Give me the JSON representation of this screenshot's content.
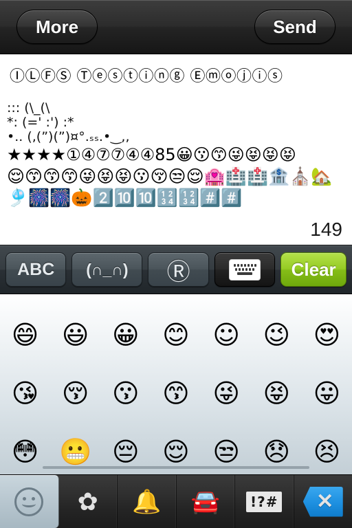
{
  "top_toolbar": {
    "more_label": "More",
    "send_label": "Send"
  },
  "message": {
    "title": "ⒾⓁⒻⓈ Ⓣⓔⓢⓣⓘⓝⓖ Ⓔⓜⓞⓙⓘⓢ",
    "ascii_art": "::: (\\_(\\\n*: (=' :') :*\n•.. (,(”)(”)¤°.ₛₛ.•‿,,",
    "emoji_line_1": "★★★★①④⑦⑦④④85😀😗😙😜😝😝😝",
    "emoji_line_2": "😌😙😙😙😜😝😝😗😚😒😌🏩🏥🏥🏦⛪🏡",
    "emoji_line_3": "🎐🎆🎆🎃2️⃣🔟🔟🔢🔢#️⃣#️⃣",
    "char_count": "149"
  },
  "mid_bar": {
    "abc_label": "ABC",
    "kaomoji_label": "(∩_∩)",
    "registered_label": "Ⓡ",
    "keyboard_icon": "keyboard-icon",
    "clear_label": "Clear"
  },
  "emoji_pad": {
    "rows": [
      [
        "😄",
        "😃",
        "😀",
        "😊",
        "☺",
        "😉",
        "😍"
      ],
      [
        "😘",
        "😚",
        "😗",
        "😙",
        "😜",
        "😝",
        "😛"
      ],
      [
        "😳",
        "😬",
        "😔",
        "😌",
        "😒",
        "😞",
        "😣"
      ]
    ]
  },
  "tabbar": {
    "tabs": [
      {
        "name": "tab-smileys",
        "icon": "smiley-icon",
        "glyph": ""
      },
      {
        "name": "tab-nature",
        "icon": "flower-icon",
        "glyph": "✿"
      },
      {
        "name": "tab-objects",
        "icon": "bell-icon",
        "glyph": "🔔"
      },
      {
        "name": "tab-travel",
        "icon": "car-icon",
        "glyph": "🚘"
      },
      {
        "name": "tab-symbols",
        "icon": "punctuation-icon",
        "glyph": "!?#"
      },
      {
        "name": "tab-delete",
        "icon": "delete-key-icon",
        "glyph": "✕"
      }
    ]
  },
  "colors": {
    "accent_green": "#96cc24",
    "delete_blue": "#1d8fe0",
    "toolbar_dark": "#2c2c2c",
    "pad_bottom": "#c3cfd6"
  }
}
